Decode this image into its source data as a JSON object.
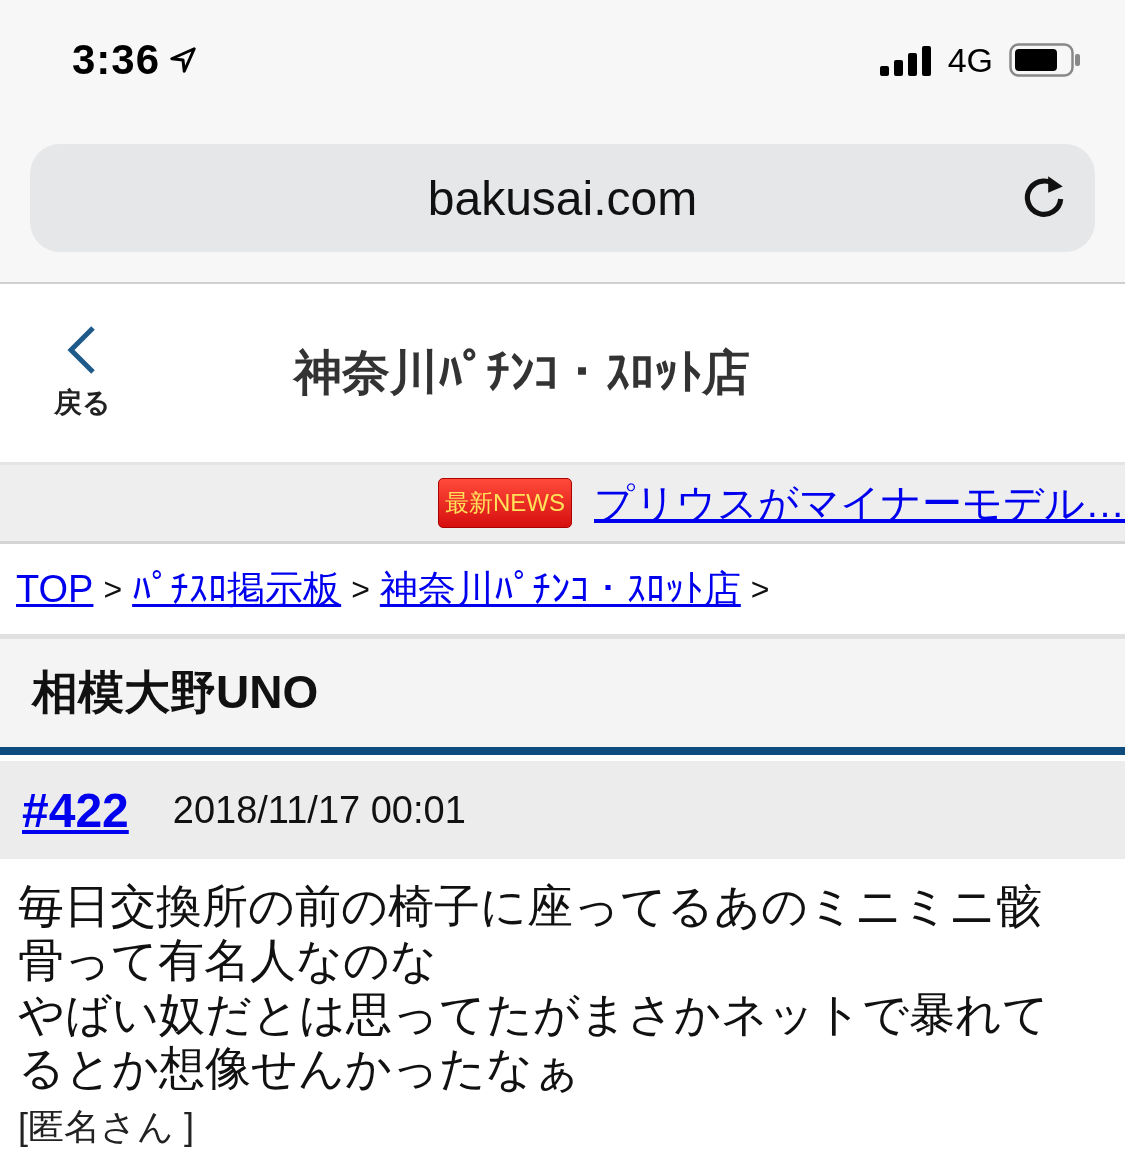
{
  "status_bar": {
    "time": "3:36",
    "network": "4G"
  },
  "address_bar": {
    "url": "bakusai.com"
  },
  "header": {
    "back_label": "戻る",
    "title": "神奈川ﾊﾟﾁﾝｺ・ｽﾛｯﾄ店"
  },
  "news": {
    "badge": "最新NEWS",
    "headline": "プリウスがマイナーモデル…"
  },
  "breadcrumb": [
    {
      "label": "TOP",
      "kind": "link"
    },
    {
      "label": ">",
      "kind": "separator"
    },
    {
      "label": "ﾊﾟﾁｽﾛ掲示板",
      "kind": "link"
    },
    {
      "label": ">",
      "kind": "separator"
    },
    {
      "label": "神奈川ﾊﾟﾁﾝｺ・ｽﾛｯﾄ店",
      "kind": "link"
    },
    {
      "label": ">",
      "kind": "separator"
    }
  ],
  "thread": {
    "title": "相模大野UNO"
  },
  "posts": [
    {
      "number": "#422",
      "date": "2018/11/17 00:01",
      "body_lines": [
        "毎日交換所の前の椅子に座ってるあのミニミニ骸骨って有名人なのな",
        "やばい奴だとは思ってたがまさかネットで暴れてるとか想像せんかったなぁ"
      ],
      "author": "[匿名さん ]"
    }
  ]
}
